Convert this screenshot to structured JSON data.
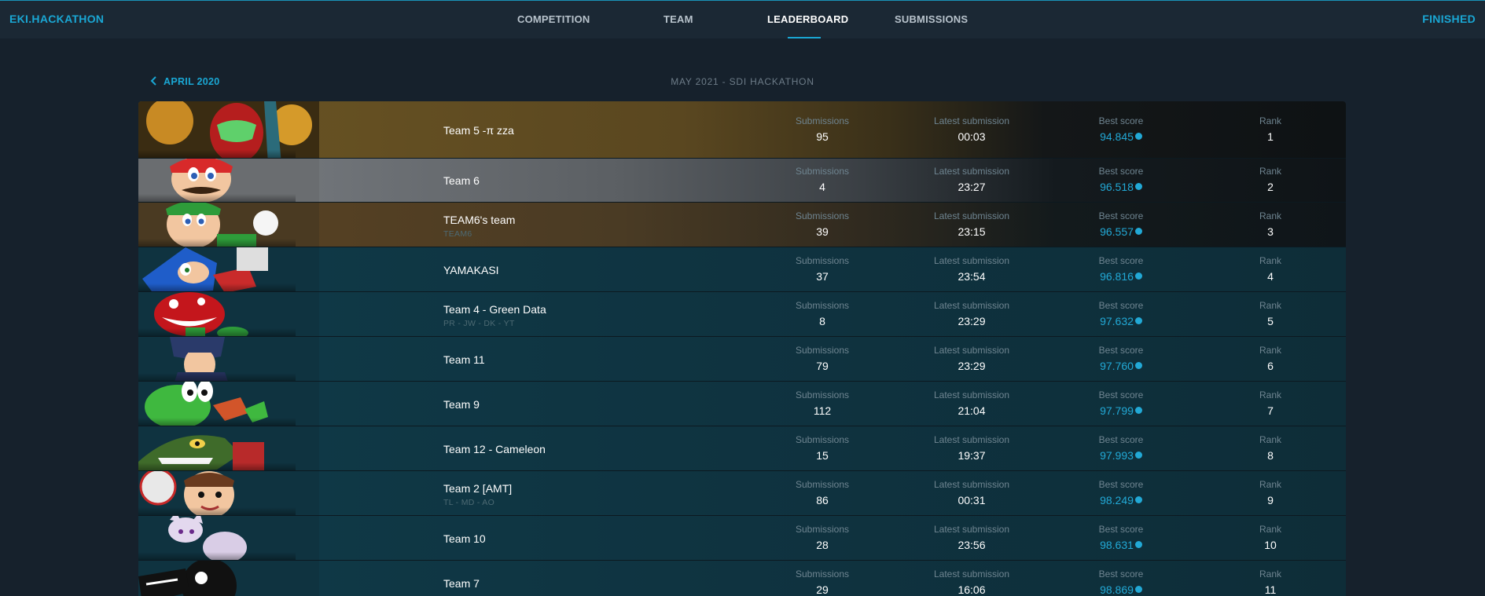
{
  "header": {
    "brand": "EKI.HACKATHON",
    "status": "FINISHED",
    "nav": [
      {
        "label": "COMPETITION",
        "active": false
      },
      {
        "label": "TEAM",
        "active": false
      },
      {
        "label": "LEADERBOARD",
        "active": true
      },
      {
        "label": "SUBMISSIONS",
        "active": false
      }
    ]
  },
  "subheader": {
    "back_label": "APRIL 2020",
    "title": "MAY 2021 - SDI HACKATHON"
  },
  "columns": {
    "submissions": "Submissions",
    "latest": "Latest submission",
    "best": "Best score",
    "rank": "Rank"
  },
  "colors": {
    "accent": "#1aa7d4",
    "gold_row": "#5a4720",
    "silver_row": "#5b5f63",
    "bronze_row": "#4a3b24",
    "default_row": "#0f3340"
  },
  "teams": [
    {
      "name": "Team 5 -π zza",
      "members": "",
      "submissions": "95",
      "latest": "00:03",
      "best": "94.845",
      "rank": "1",
      "tier": "gold",
      "character": "samus-icon"
    },
    {
      "name": "Team 6",
      "members": "",
      "submissions": "4",
      "latest": "23:27",
      "best": "96.518",
      "rank": "2",
      "tier": "silver",
      "character": "mario-icon"
    },
    {
      "name": "TEAM6's team",
      "members": "TEAM6",
      "submissions": "39",
      "latest": "23:15",
      "best": "96.557",
      "rank": "3",
      "tier": "bronze",
      "character": "luigi-icon"
    },
    {
      "name": "YAMAKASI",
      "members": "",
      "submissions": "37",
      "latest": "23:54",
      "best": "96.816",
      "rank": "4",
      "tier": "default",
      "character": "sonic-icon"
    },
    {
      "name": "Team 4 - Green Data",
      "members": "PR - JW - DK - YT",
      "submissions": "8",
      "latest": "23:29",
      "best": "97.632",
      "rank": "5",
      "tier": "default",
      "character": "piranha-plant-icon"
    },
    {
      "name": "Team 11",
      "members": "",
      "submissions": "79",
      "latest": "23:29",
      "best": "97.760",
      "rank": "6",
      "tier": "default",
      "character": "chrom-icon"
    },
    {
      "name": "Team 9",
      "members": "",
      "submissions": "112",
      "latest": "21:04",
      "best": "97.799",
      "rank": "7",
      "tier": "default",
      "character": "yoshi-icon"
    },
    {
      "name": "Team 12 - Cameleon",
      "members": "",
      "submissions": "15",
      "latest": "19:37",
      "best": "97.993",
      "rank": "8",
      "tier": "default",
      "character": "king-k-rool-icon"
    },
    {
      "name": "Team 2 [AMT]",
      "members": "TL - MD - AO",
      "submissions": "86",
      "latest": "00:31",
      "best": "98.249",
      "rank": "9",
      "tier": "default",
      "character": "villager-icon"
    },
    {
      "name": "Team 10",
      "members": "",
      "submissions": "28",
      "latest": "23:56",
      "best": "98.631",
      "rank": "10",
      "tier": "default",
      "character": "mewtwo-icon"
    },
    {
      "name": "Team 7",
      "members": "",
      "submissions": "29",
      "latest": "16:06",
      "best": "98.869",
      "rank": "11",
      "tier": "default",
      "character": "game-and-watch-icon"
    }
  ]
}
